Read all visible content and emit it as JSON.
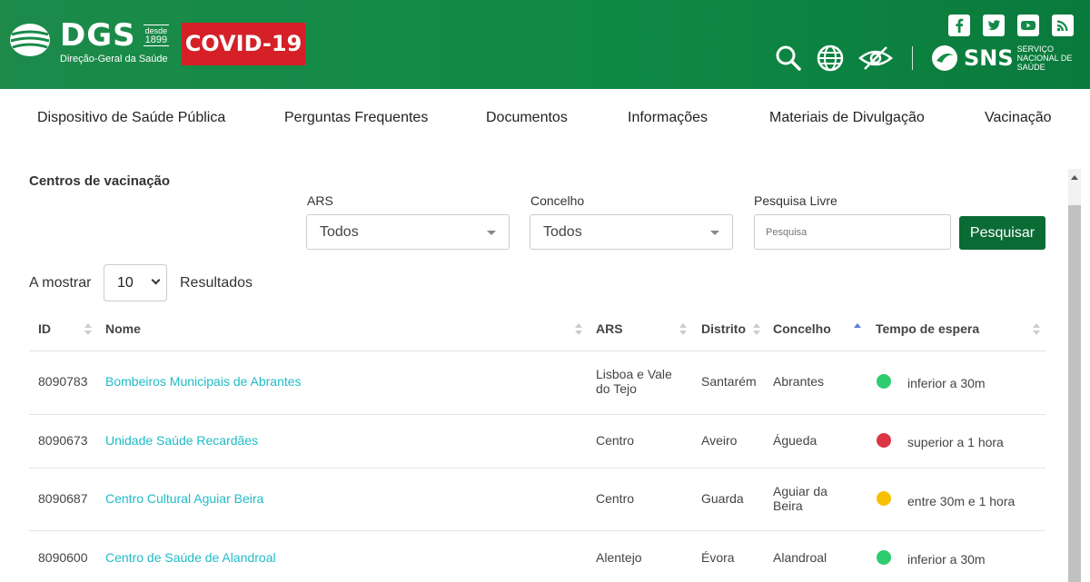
{
  "header": {
    "logo": {
      "name": "DGS",
      "since_label": "desde",
      "since_year": "1899",
      "subtitle": "Direção-Geral da Saúde"
    },
    "covid_label": "COVID-19",
    "social_icons": [
      "facebook-icon",
      "twitter-icon",
      "youtube-icon",
      "rss-icon"
    ],
    "tool_icons": [
      "search-icon",
      "globe-icon",
      "accessibility-eye-icon"
    ],
    "sns": {
      "name": "SNS",
      "subtitle": "SERVIÇO NACIONAL DE SAÚDE"
    }
  },
  "nav": {
    "items": [
      "Dispositivo de Saúde Pública",
      "Perguntas Frequentes",
      "Documentos",
      "Informações",
      "Materiais de Divulgação",
      "Vacinação"
    ]
  },
  "main": {
    "title": "Centros de vacinação",
    "filters": {
      "ars": {
        "label": "ARS",
        "value": "Todos"
      },
      "concelho": {
        "label": "Concelho",
        "value": "Todos"
      },
      "search": {
        "label": "Pesquisa Livre",
        "placeholder": "Pesquisa",
        "button": "Pesquisar"
      }
    },
    "length": {
      "prefix": "A mostrar",
      "value": "10",
      "suffix": "Resultados"
    },
    "table": {
      "columns": [
        "ID",
        "Nome",
        "ARS",
        "Distrito",
        "Concelho",
        "Tempo de espera"
      ],
      "rows": [
        {
          "id": "8090783",
          "nome": "Bombeiros Municipais de Abrantes",
          "ars": "Lisboa e Vale do Tejo",
          "distrito": "Santarém",
          "concelho": "Abrantes",
          "status_color": "#2ecc71",
          "tempo": "inferior a 30m"
        },
        {
          "id": "8090673",
          "nome": "Unidade Saúde Recardães",
          "ars": "Centro",
          "distrito": "Aveiro",
          "concelho": "Águeda",
          "status_color": "#dc3545",
          "tempo": "superior a 1 hora"
        },
        {
          "id": "8090687",
          "nome": "Centro Cultural Aguiar Beira",
          "ars": "Centro",
          "distrito": "Guarda",
          "concelho": "Aguiar da Beira",
          "status_color": "#f6c000",
          "tempo": "entre 30m e 1 hora"
        },
        {
          "id": "8090600",
          "nome": "Centro de Saúde de Alandroal",
          "ars": "Alentejo",
          "distrito": "Évora",
          "concelho": "Alandroal",
          "status_color": "#2ecc71",
          "tempo": "inferior a 30m"
        }
      ]
    }
  }
}
